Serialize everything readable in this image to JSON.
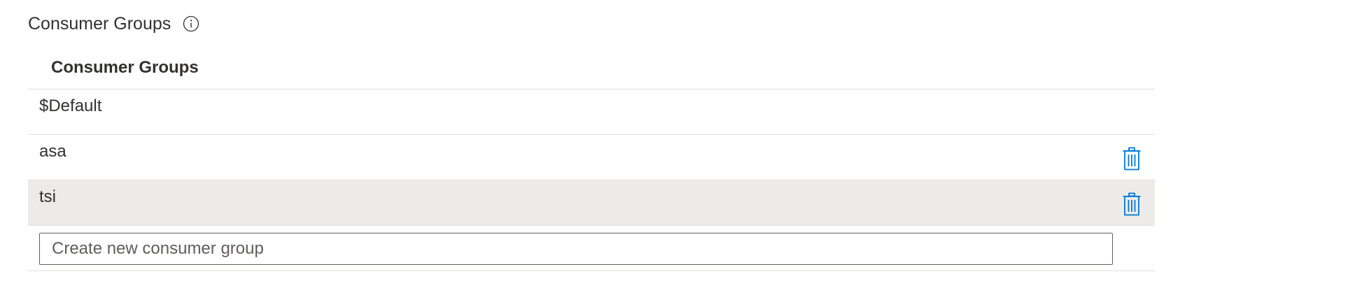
{
  "section": {
    "title": "Consumer Groups",
    "info_icon": "info-icon"
  },
  "grid": {
    "column_header": "Consumer Groups",
    "rows": [
      {
        "name": "$Default",
        "deletable": false,
        "selected": false
      },
      {
        "name": "asa",
        "deletable": true,
        "selected": false
      },
      {
        "name": "tsi",
        "deletable": true,
        "selected": true
      }
    ],
    "delete_icon": "trash-icon"
  },
  "new_group": {
    "placeholder": "Create new consumer group",
    "value": ""
  },
  "colors": {
    "accent": "#0078d4",
    "selected_row_bg": "#edebe9",
    "divider": "#e1dfdd",
    "text": "#323130"
  }
}
